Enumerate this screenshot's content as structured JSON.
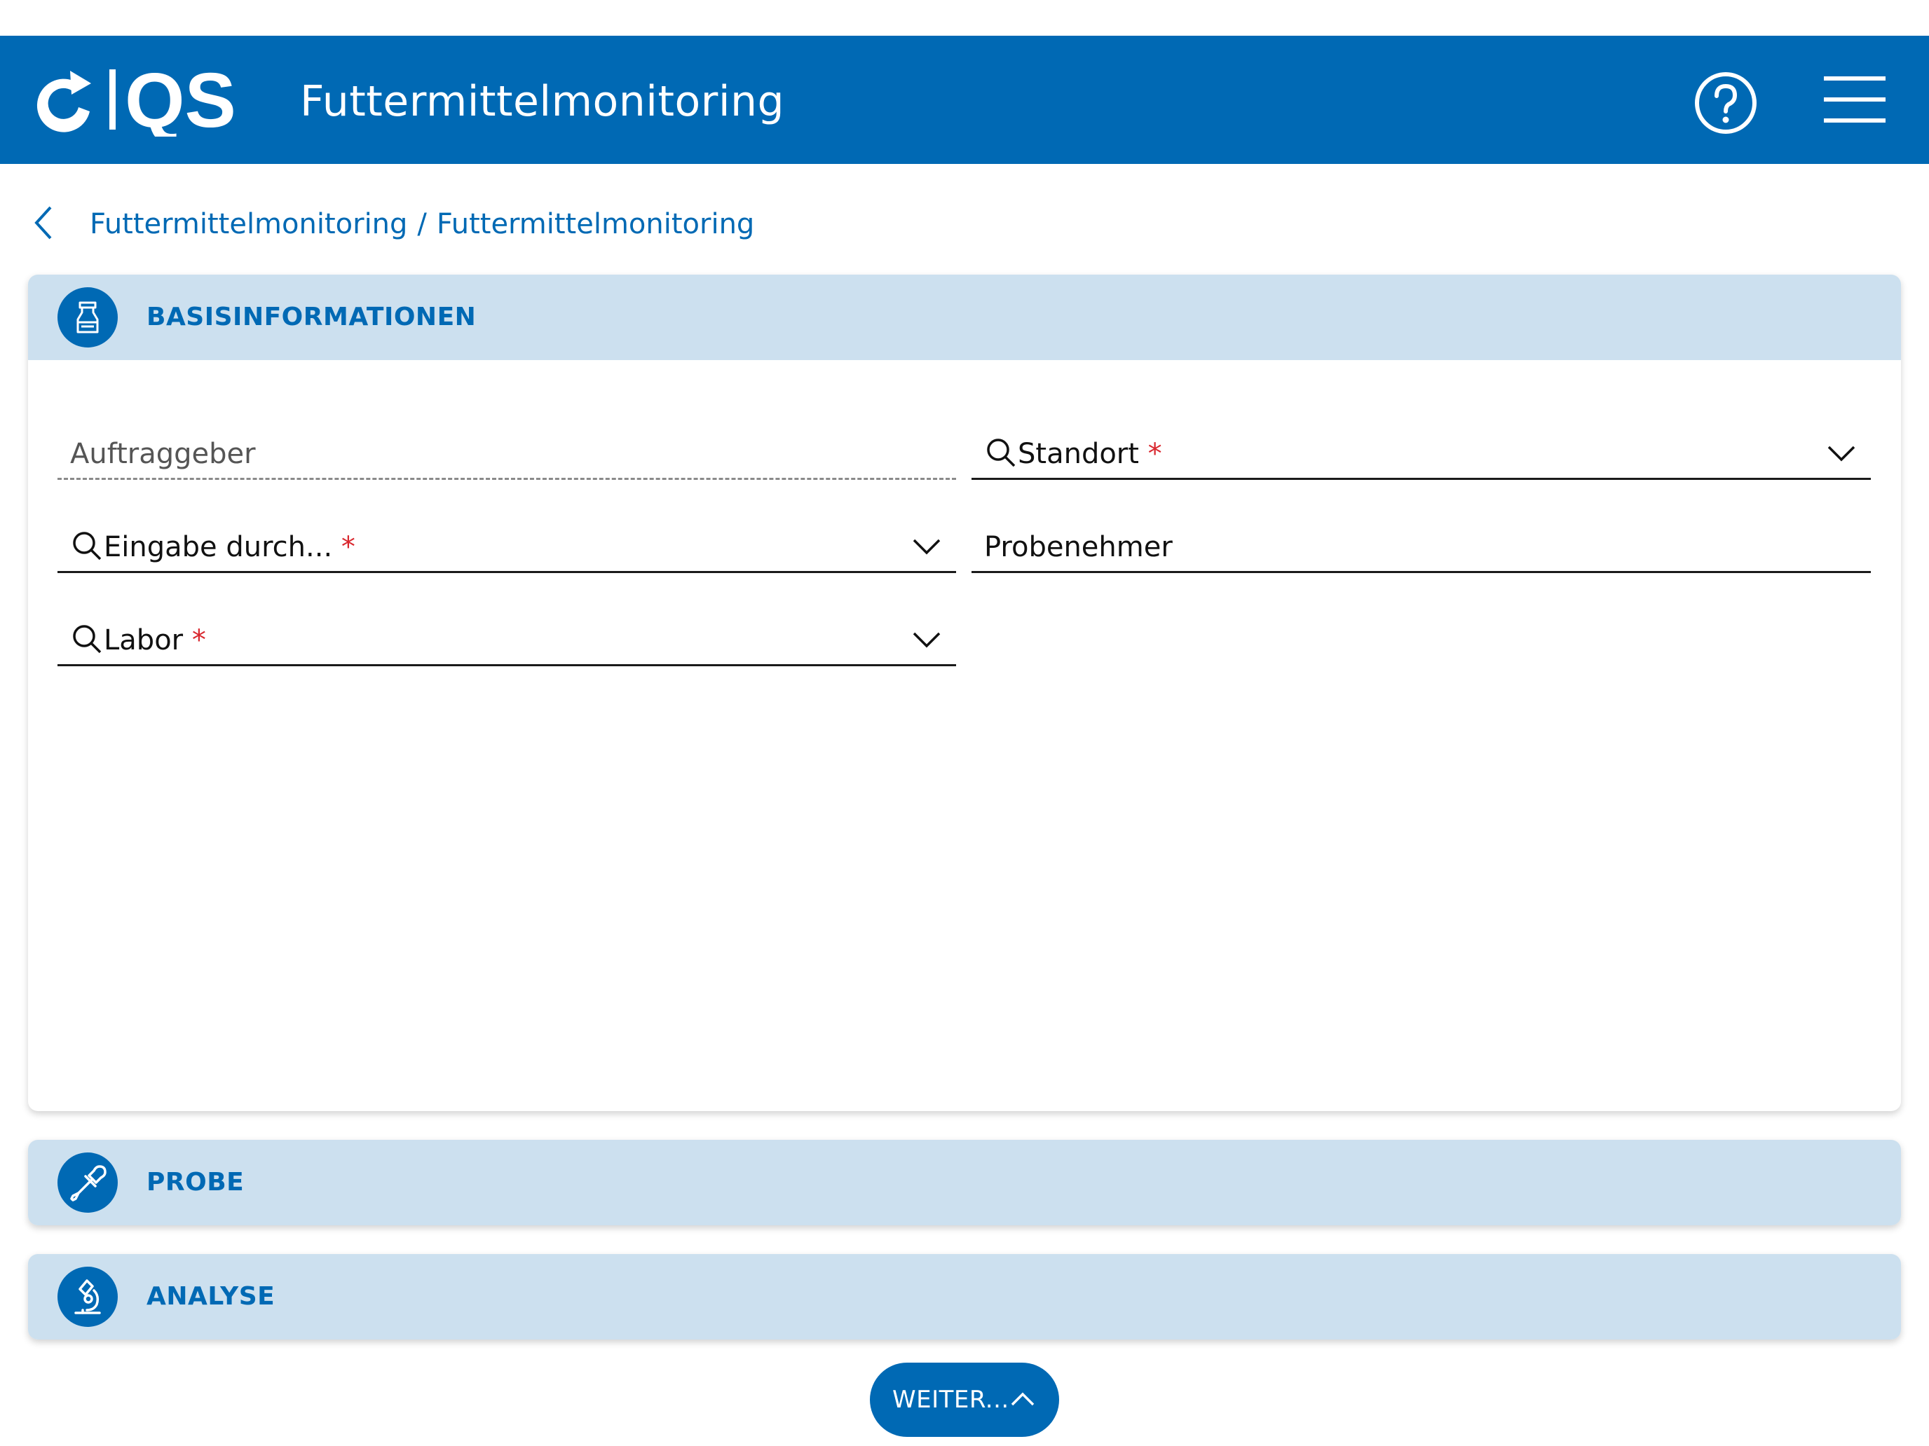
{
  "header": {
    "logo_text": "QS",
    "title": "Futtermittelmonitoring",
    "help_icon": "help-circle-icon",
    "menu_icon": "hamburger-menu-icon"
  },
  "breadcrumb": {
    "back_icon": "chevron-left-icon",
    "items": [
      "Futtermittelmonitoring",
      "Futtermittelmonitoring"
    ],
    "separator": "/"
  },
  "sections": {
    "basis": {
      "label": "BASISINFORMATIONEN",
      "icon": "feed-sample-icon"
    },
    "probe": {
      "label": "PROBE",
      "icon": "pipette-icon"
    },
    "analyse": {
      "label": "ANALYSE",
      "icon": "microscope-icon"
    }
  },
  "form": {
    "auftraggeber": {
      "label": "Auftraggeber"
    },
    "standort": {
      "label": "Standort",
      "required_mark": "*"
    },
    "eingabe": {
      "label": "Eingabe durch...",
      "required_mark": "*"
    },
    "probenehmer": {
      "label": "Probenehmer"
    },
    "labor": {
      "label": "Labor",
      "required_mark": "*"
    }
  },
  "footer": {
    "next_label": "WEITER...",
    "next_icon": "chevron-up-icon"
  },
  "colors": {
    "brand_blue": "#0069b4",
    "section_header_bg": "#cce0ef",
    "required_red": "#d9282f"
  }
}
